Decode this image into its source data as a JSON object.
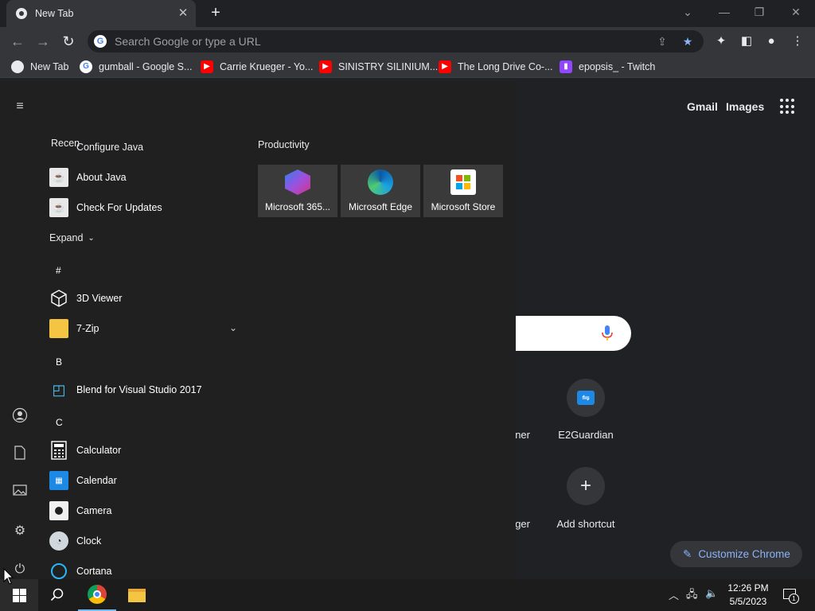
{
  "browser": {
    "tab_title": "New Tab",
    "tab_close": "✕",
    "new_tab": "+",
    "omnibox_placeholder": "Search Google or type a URL",
    "bookmarks": [
      {
        "label": "New Tab",
        "icon": "chrome-icon"
      },
      {
        "label": "gumball - Google S...",
        "icon": "google-icon"
      },
      {
        "label": "Carrie Krueger - Yo...",
        "icon": "youtube-icon"
      },
      {
        "label": "SINISTRY SILINIUM...",
        "icon": "youtube-icon"
      },
      {
        "label": "The Long Drive Co-...",
        "icon": "youtube-icon"
      },
      {
        "label": "epopsis_ - Twitch",
        "icon": "twitch-icon"
      }
    ]
  },
  "ntp": {
    "gmail": "Gmail",
    "images": "Images",
    "shortcuts": [
      {
        "label": "ner"
      },
      {
        "label": "E2Guardian"
      },
      {
        "label": "ger"
      },
      {
        "label": "Add shortcut"
      }
    ],
    "customize": "Customize Chrome"
  },
  "start_menu": {
    "recent_header": "Recen",
    "recent": [
      "Configure Java",
      "About Java",
      "Check For Updates"
    ],
    "expand": "Expand",
    "groups": [
      {
        "letter": "#",
        "apps": [
          "3D Viewer",
          "7-Zip"
        ]
      },
      {
        "letter": "B",
        "apps": [
          "Blend for Visual Studio 2017"
        ]
      },
      {
        "letter": "C",
        "apps": [
          "Calculator",
          "Calendar",
          "Camera",
          "Clock",
          "Cortana"
        ]
      }
    ],
    "productivity_header": "Productivity",
    "tiles": [
      "Microsoft 365...",
      "Microsoft Edge",
      "Microsoft Store"
    ]
  },
  "taskbar": {
    "time": "12:26 PM",
    "date": "5/5/2023",
    "notification_count": "1"
  },
  "colors": {
    "accent_link": "#8ab4f8",
    "start_bg": "#202020",
    "chrome_bg": "#202124"
  }
}
